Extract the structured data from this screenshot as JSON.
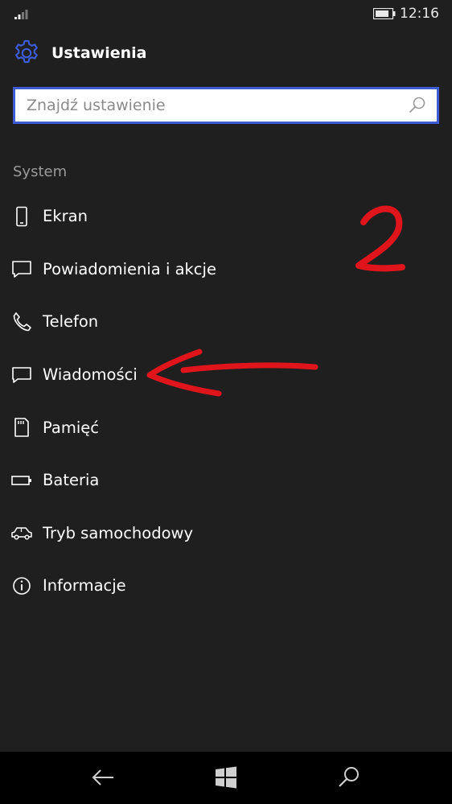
{
  "status_bar": {
    "time": "12:16",
    "signal_icon": "signal-bars-icon",
    "battery_icon": "battery-icon"
  },
  "header": {
    "title": "Ustawienia",
    "icon": "gear-icon",
    "accent_color": "#3e5bd6"
  },
  "search": {
    "placeholder": "Znajdź ustawienie",
    "value": "",
    "icon": "search-icon"
  },
  "section": {
    "label": "System"
  },
  "menu": {
    "items": [
      {
        "label": "Ekran",
        "icon": "phone-screen-icon"
      },
      {
        "label": "Powiadomienia i akcje",
        "icon": "notification-icon"
      },
      {
        "label": "Telefon",
        "icon": "phone-handset-icon"
      },
      {
        "label": "Wiadomości",
        "icon": "message-icon"
      },
      {
        "label": "Pamięć",
        "icon": "sd-card-icon"
      },
      {
        "label": "Bateria",
        "icon": "battery-icon"
      },
      {
        "label": "Tryb samochodowy",
        "icon": "car-icon"
      },
      {
        "label": "Informacje",
        "icon": "info-icon"
      }
    ]
  },
  "annotation": {
    "number": "2",
    "color": "#e0151b",
    "points_to": "Wiadomości"
  },
  "nav_bar": {
    "back_icon": "back-arrow-icon",
    "start_icon": "windows-logo-icon",
    "search_icon": "search-icon"
  }
}
